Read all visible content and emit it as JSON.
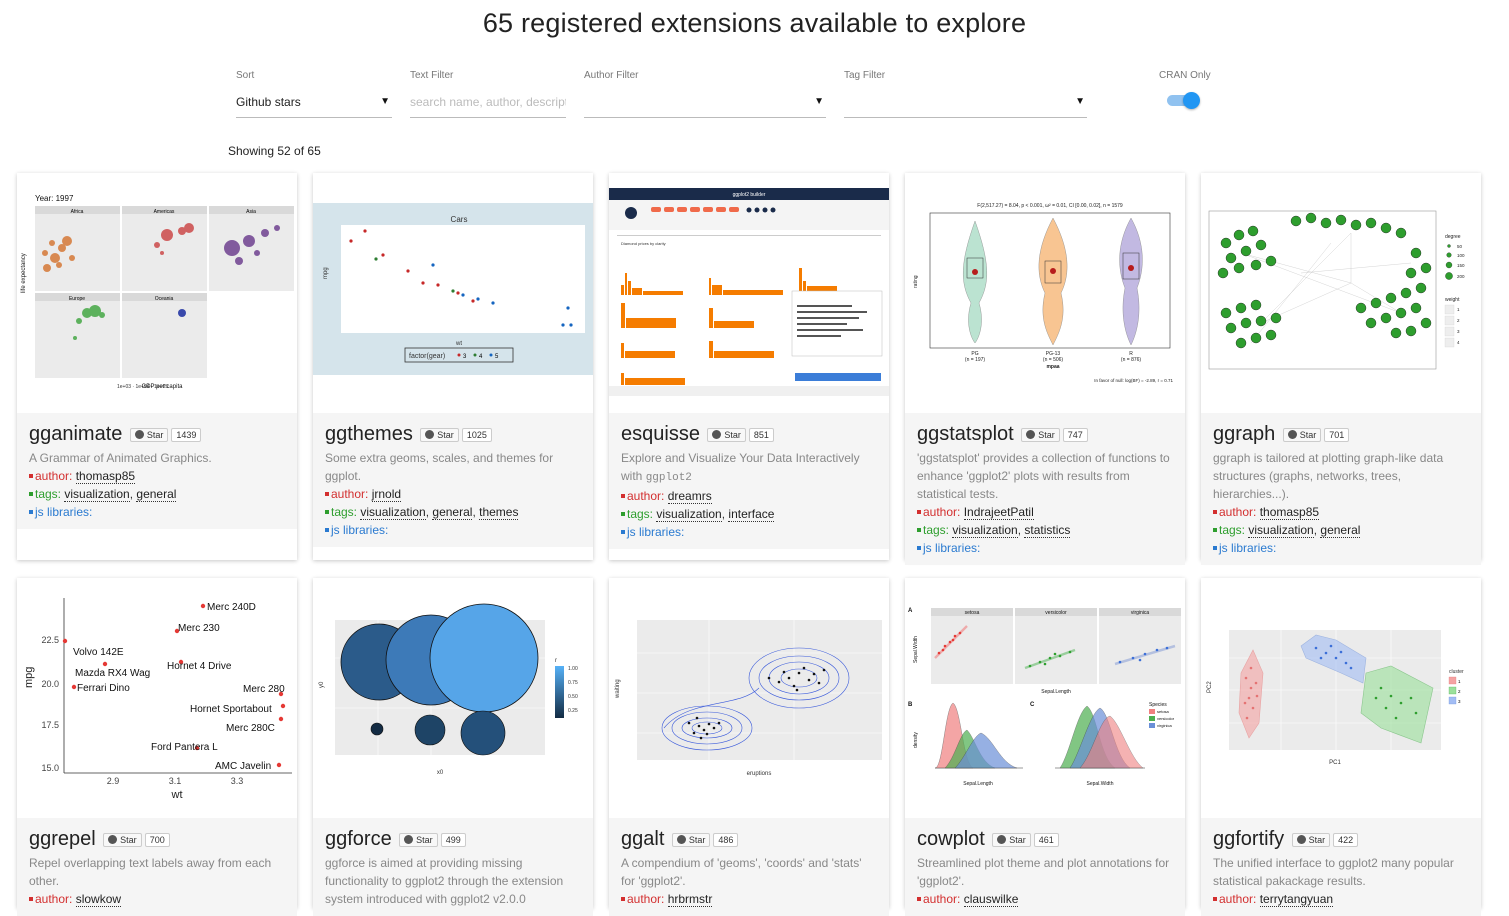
{
  "title": "65 registered extensions available to explore",
  "filters": {
    "sort": {
      "label": "Sort",
      "value": "Github stars"
    },
    "text": {
      "label": "Text Filter",
      "placeholder": "search name, author, descript"
    },
    "author": {
      "label": "Author Filter"
    },
    "tag": {
      "label": "Tag Filter"
    },
    "cran": {
      "label": "CRAN Only",
      "enabled": true
    }
  },
  "showing": "Showing 52 of 65",
  "labels": {
    "star": "Star",
    "author": "author:",
    "tags": "tags:",
    "js": "js libraries:",
    "comma": ", "
  },
  "cards": [
    {
      "name": "gganimate",
      "stars": "1439",
      "desc": "A Grammar of Animated Graphics.",
      "author": "thomasp85",
      "tags": [
        "visualization",
        "general"
      ],
      "thumb": {
        "year": "Year: 1997",
        "panels": [
          "Africa",
          "Americas",
          "Asia",
          "Europe",
          "Oceania"
        ],
        "xlabel": "GDP per capita",
        "ylabel": "life expectancy"
      }
    },
    {
      "name": "ggthemes",
      "stars": "1025",
      "desc": "Some extra geoms, scales, and themes for ggplot.",
      "author": "jrnold",
      "tags": [
        "visualization",
        "general",
        "themes"
      ],
      "thumb": {
        "title": "Cars",
        "xlabel": "wt",
        "ylabel": "mpg",
        "legend": "factor(gear)",
        "legend_items": [
          "3",
          "4",
          "5"
        ]
      }
    },
    {
      "name": "esquisse",
      "stars": "851",
      "desc": "Explore and Visualize Your Data Interactively with ",
      "desc_code": "ggplot2",
      "author": "dreamrs",
      "tags": [
        "visualization",
        "interface"
      ],
      "thumb": {
        "header": "ggplot2 builder",
        "chart_title": "Diamond prices by clarity"
      }
    },
    {
      "name": "ggstatsplot",
      "stars": "747",
      "desc": "'ggstatsplot' provides a collection of functions to enhance 'ggplot2' plots with results from statistical tests.",
      "author": "IndrajeetPatil",
      "tags": [
        "visualization",
        "statistics"
      ],
      "thumb": {
        "stat": "F(2,517.27) = 8.04, p < 0.001, ω² = 0.01, CI [0.00, 0.02], n = 1579",
        "groups": [
          "PG",
          "PG-13",
          "R"
        ],
        "ns": [
          "(n = 197)",
          "(n = 506)",
          "(n = 876)"
        ],
        "xlabel": "mpaa",
        "ylabel": "rating",
        "bf": "In favor of null: log(BF) = -2.89, r = 0.71"
      }
    },
    {
      "name": "ggraph",
      "stars": "701",
      "desc": "ggraph is tailored at plotting graph-like data structures (graphs, networks, trees, hierarchies...).",
      "author": "thomasp85",
      "tags": [
        "visualization",
        "general"
      ],
      "thumb": {
        "legend1": "degree",
        "values1": [
          "50",
          "100",
          "150",
          "200"
        ],
        "legend2": "weight",
        "values2": [
          "1",
          "2",
          "3",
          "4"
        ]
      }
    },
    {
      "name": "ggrepel",
      "stars": "700",
      "desc": "Repel overlapping text labels away from each other.",
      "author": "slowkow",
      "tags": [],
      "thumb": {
        "xlabel": "wt",
        "ylabel": "mpg",
        "labels": [
          "Merc 240D",
          "Merc 230",
          "Volvo 142E",
          "Mazda RX4 Wag",
          "Hornet 4 Drive",
          "Ferrari Dino",
          "Merc 280",
          "Hornet Sportabout",
          "Merc 280C",
          "Ford Pantera L",
          "AMC Javelin"
        ],
        "yticks": [
          "22.5",
          "20.0",
          "17.5",
          "15.0"
        ],
        "xticks": [
          "2.9",
          "3.1",
          "3.3"
        ]
      }
    },
    {
      "name": "ggforce",
      "stars": "499",
      "desc": "ggforce is aimed at providing missing functionality to ggplot2 through the extension system introduced with ggplot2 v2.0.0",
      "author": "",
      "tags": [],
      "thumb": {
        "xlabel": "x0",
        "ylabel": "y0",
        "legend": "r",
        "legend_values": [
          "1.00",
          "0.75",
          "0.50",
          "0.25"
        ]
      }
    },
    {
      "name": "ggalt",
      "stars": "486",
      "desc": "A compendium of 'geoms', 'coords' and 'stats' for 'ggplot2'.",
      "author": "hrbrmstr",
      "tags": [],
      "thumb": {
        "xlabel": "eruptions",
        "ylabel": "waiting"
      }
    },
    {
      "name": "cowplot",
      "stars": "461",
      "desc": "Streamlined plot theme and plot annotations for 'ggplot2'.",
      "author": "clauswilke",
      "tags": [],
      "thumb": {
        "panels": [
          "setosa",
          "versicolor",
          "virginica"
        ],
        "xlabel_a": "Sepal.Length",
        "ylabel_a": "Sepal.Width",
        "xlabel_b": "Sepal.Length",
        "xlabel_c": "Sepal.Width",
        "ylabel_b": "density",
        "legend": "Species",
        "letters": [
          "A",
          "B",
          "C"
        ]
      }
    },
    {
      "name": "ggfortify",
      "stars": "422",
      "desc": "The unified interface to ggplot2 many popular statistical pakackage results.",
      "author": "terrytangyuan",
      "tags": [],
      "thumb": {
        "xlabel": "PC1",
        "ylabel": "PC2",
        "legend": "cluster",
        "legend_values": [
          "1",
          "2",
          "3"
        ]
      }
    }
  ],
  "colors": {
    "accent": "#2196f3",
    "author": "#d32f2f",
    "tags": "#2e9e2e",
    "js": "#2a7ad0"
  }
}
